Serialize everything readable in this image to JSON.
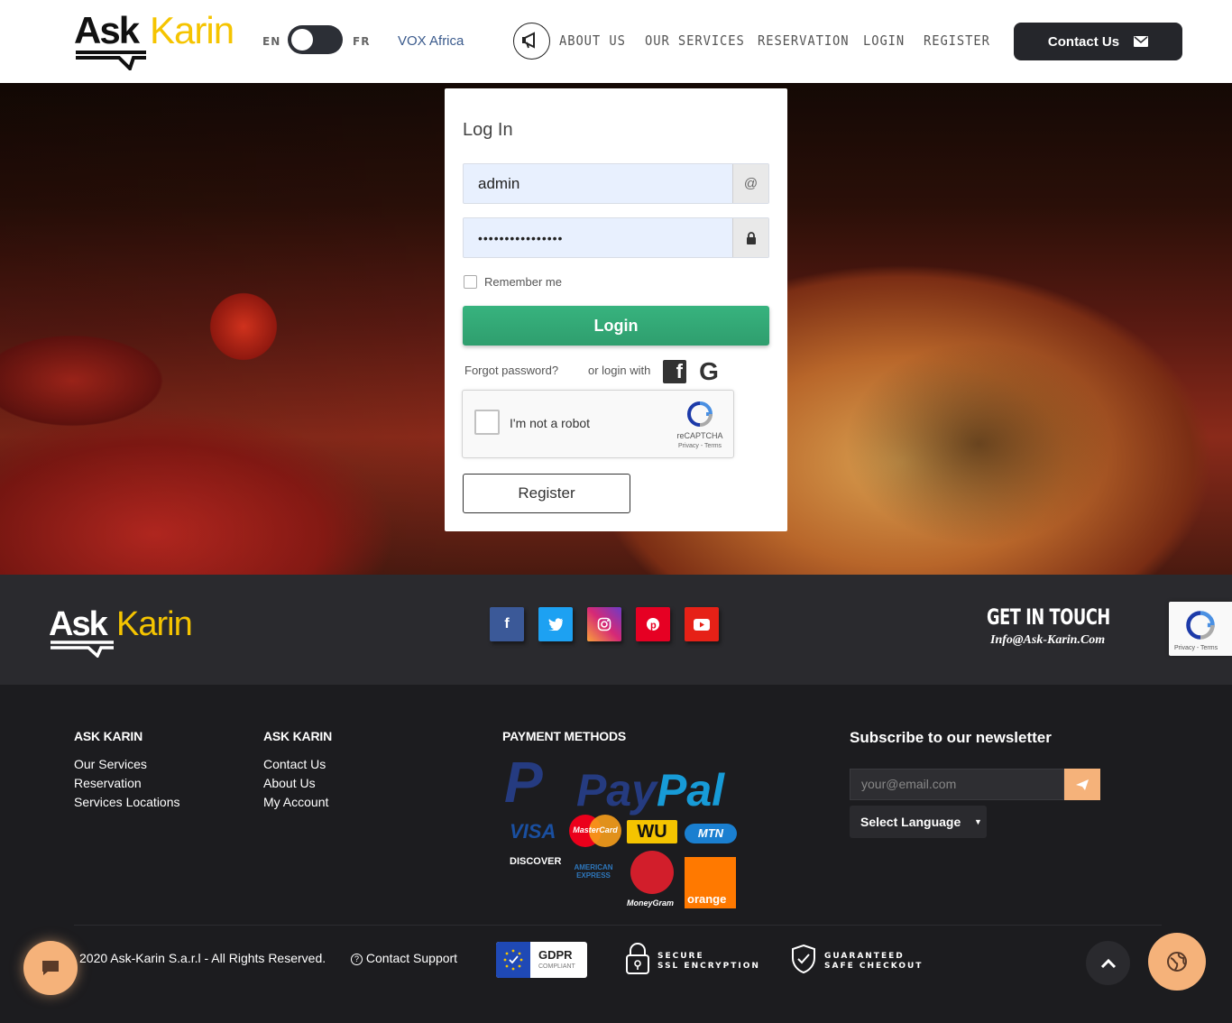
{
  "header": {
    "logo": {
      "ask": "Ask",
      "karin": "Karin"
    },
    "lang_en": "EN",
    "lang_fr": "FR",
    "vox": "VOX Africa",
    "nav": [
      "ABOUT US",
      "OUR SERVICES",
      "RESERVATION",
      "LOGIN",
      "REGISTER"
    ],
    "contact_label": "Contact Us"
  },
  "login": {
    "title": "Log In",
    "username_value": "admin",
    "username_addon": "@",
    "password_value": "••••••••••••••••",
    "remember_label": "Remember me",
    "login_button": "Login",
    "forgot": "Forgot password?",
    "or_login_with": "or login with",
    "captcha_label": "I'm not a robot",
    "captcha_brand": "reCAPTCHA",
    "captcha_links": "Privacy - Terms",
    "register_button": "Register"
  },
  "footer_top": {
    "logo": {
      "ask": "Ask",
      "karin": "Karin"
    },
    "social": [
      {
        "name": "facebook",
        "glyph": "f",
        "color": "#3b5998"
      },
      {
        "name": "twitter",
        "glyph": "t",
        "color": "#1da1f2"
      },
      {
        "name": "instagram",
        "glyph": "◎",
        "color": "#c13584"
      },
      {
        "name": "pinterest",
        "glyph": "P",
        "color": "#e60023"
      },
      {
        "name": "youtube",
        "glyph": "▶",
        "color": "#e62117"
      }
    ],
    "get_in_touch": "GET IN TOUCH",
    "email": "Info@Ask-Karin.Com",
    "badge_links": "Privacy - Terms"
  },
  "footer": {
    "col1": {
      "title": "ASK KARIN",
      "links": [
        "Our Services",
        "Reservation",
        "Services Locations"
      ]
    },
    "col2": {
      "title": "ASK KARIN",
      "links": [
        "Contact Us",
        "About Us",
        "My Account"
      ]
    },
    "payment": {
      "title": "PAYMENT METHODS",
      "paypal": "PayPal",
      "visa": "VISA",
      "mastercard": "MasterCard",
      "wu": "WU",
      "mtn": "MTN",
      "discover": "DISCOVER",
      "amex": "AMERICAN EXPRESS",
      "moneygram": "MoneyGram",
      "orange": "orange"
    },
    "newsletter_title": "Subscribe to our newsletter",
    "newsletter_placeholder": "your@email.com",
    "language_select": "Select Language",
    "copyright": "2020 Ask-Karin S.a.r.l - All Rights Reserved.",
    "support": "Contact Support",
    "gdpr": "GDPR",
    "gdpr_sub": "COMPLIANT",
    "ssl_line1": "SECURE",
    "ssl_line2": "SSL ENCRYPTION",
    "checkout_line1": "GUARANTEED",
    "checkout_line2": "SAFE CHECKOUT"
  },
  "colors": {
    "brand_yellow": "#f5c400",
    "login_green": "#34a874",
    "accent_orange": "#f5b27a",
    "dark": "#25262b"
  }
}
